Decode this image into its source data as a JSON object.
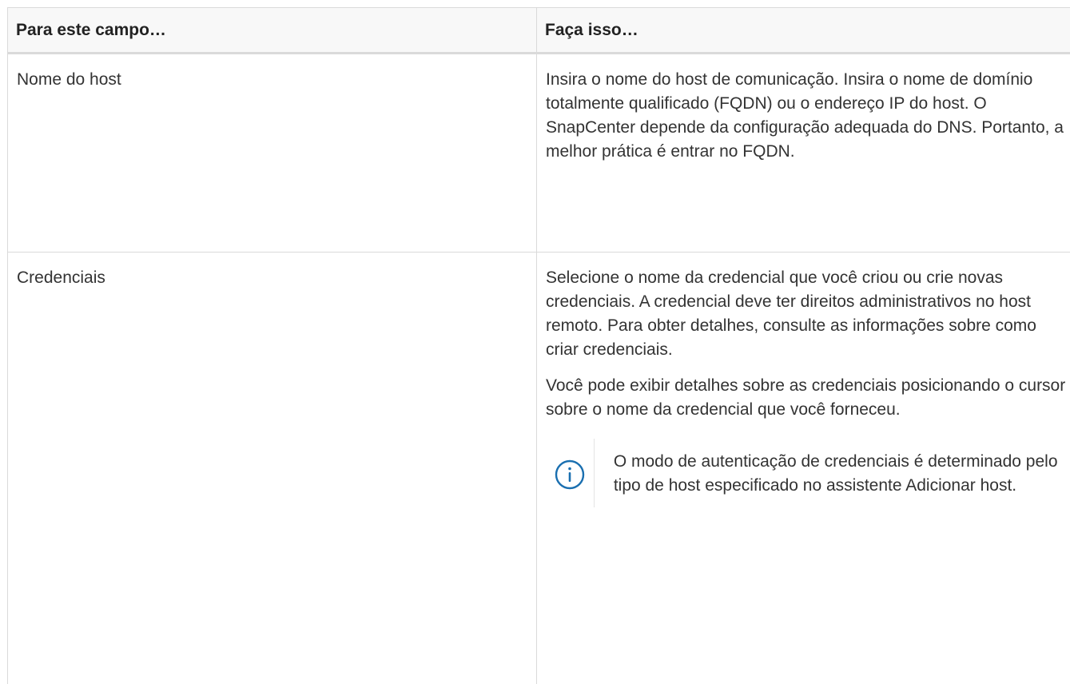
{
  "table": {
    "headers": {
      "field": "Para este campo…",
      "action": "Faça isso…"
    },
    "rows": [
      {
        "field": "Nome do host",
        "action": [
          "Insira o nome do host de comunicação. Insira o nome de domínio totalmente qualificado (FQDN) ou o endereço IP do host. O SnapCenter depende da configuração adequada do DNS. Portanto, a melhor prática é entrar no FQDN."
        ]
      },
      {
        "field": "Credenciais",
        "action": [
          "Selecione o nome da credencial que você criou ou crie novas credenciais. A credencial deve ter direitos administrativos no host remoto. Para obter detalhes, consulte as informações sobre como criar credenciais.",
          "Você pode exibir detalhes sobre as credenciais posicionando o cursor sobre o nome da credencial que você forneceu."
        ],
        "note": {
          "icon": "info-icon",
          "text": "O modo de autenticação de credenciais é determinado pelo tipo de host especificado no assistente Adicionar host."
        }
      }
    ]
  },
  "colors": {
    "border": "#dadada",
    "header_bg": "#f8f8f8",
    "text": "#333333",
    "icon": "#1a6fb0"
  }
}
